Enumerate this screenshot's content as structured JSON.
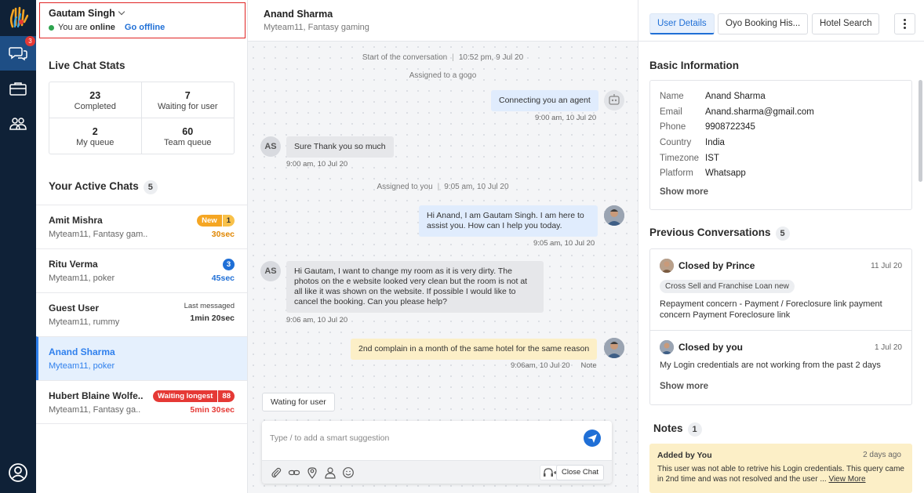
{
  "colors": {
    "rail_bg": "#0f2137",
    "accent": "#1f6fd6",
    "alert": "#e53935",
    "online": "#2ea44f",
    "note_bg": "#fcefc7"
  },
  "rail": {
    "chat_badge": "3"
  },
  "agent": {
    "name": "Gautam Singh",
    "status_prefix": "You are",
    "status": "online",
    "go_offline": "Go offline"
  },
  "stats": {
    "title": "Live Chat Stats",
    "items": [
      {
        "value": "23",
        "label": "Completed"
      },
      {
        "value": "7",
        "label": "Waiting for user"
      },
      {
        "value": "2",
        "label": "My queue"
      },
      {
        "value": "60",
        "label": "Team queue"
      }
    ]
  },
  "active_chats": {
    "title": "Your Active Chats",
    "count": "5",
    "items": [
      {
        "name": "Amit Mishra",
        "sub": "Myteam11, Fantasy gam..",
        "tag": "New",
        "tag_count": "1",
        "time": "30sec"
      },
      {
        "name": "Ritu Verma",
        "sub": "Myteam11, poker",
        "badge": "3",
        "time": "45sec"
      },
      {
        "name": "Guest User",
        "sub": "Myteam11, rummy",
        "note": "Last messaged",
        "time": "1min 20sec"
      },
      {
        "name": "Anand Sharma",
        "sub": "Myteam11, poker"
      },
      {
        "name": "Hubert Blaine Wolfe..",
        "sub": "Myteam11, Fantasy ga..",
        "tag": "Waiting longest",
        "tag_count": "88",
        "time": "5min 30sec"
      }
    ]
  },
  "conversation": {
    "title": "Anand Sharma",
    "subtitle": "Myteam11, Fantasy gaming",
    "start_label": "Start of the conversation",
    "start_time": "10:52 pm, 9 Jul 20",
    "assigned_gogo": "Assigned to a gogo",
    "assigned_you": "Assigned to you",
    "assigned_you_time": "9:05 am, 10 Jul 20",
    "messages": [
      {
        "text": "Connecting you an agent",
        "time": "9:00 am, 10 Jul 20"
      },
      {
        "avatar": "AS",
        "text": "Sure Thank you so much",
        "time": "9:00 am,  10 Jul 20"
      },
      {
        "text": "Hi Anand, I am Gautam Singh. I am here to assist you. How can I help you today.",
        "time": "9:05 am,  10 Jul 20"
      },
      {
        "avatar": "AS",
        "text": "Hi Gautam, I want to change my room as it is very dirty. The photos on the e website looked very clean but the room is not at all like it was shown on the website. If possible I would like to cancel the booking. Can you please help?",
        "time": "9:06 am,  10 Jul 20"
      },
      {
        "text": "2nd complain in a month of the same hotel for the same reason",
        "time": "9:06am, 10 Jul 20",
        "note": "Note"
      }
    ],
    "waiting_button": "Wating for user",
    "composer_placeholder": "Type / to add a smart suggestion",
    "close_chat": "Close Chat"
  },
  "tabs": [
    "User Details",
    "Oyo Booking His...",
    "Hotel Search"
  ],
  "basic_info": {
    "title": "Basic Information",
    "rows": [
      {
        "k": "Name",
        "v": "Anand Sharma"
      },
      {
        "k": "Email",
        "v": "Anand.sharma@gmail.com"
      },
      {
        "k": "Phone",
        "v": "9908722345"
      },
      {
        "k": "Country",
        "v": "India"
      },
      {
        "k": "Timezone",
        "v": "IST"
      },
      {
        "k": "Platform",
        "v": "Whatsapp"
      }
    ],
    "show_more": "Show more"
  },
  "previous": {
    "title": "Previous Conversations",
    "count": "5",
    "items": [
      {
        "closed": "Closed by Prince",
        "date": "11 Jul 20",
        "tag": "Cross Sell and Franchise Loan new",
        "text": "Repayment concern - Payment / Foreclosure link payment concern Payment Foreclosure link"
      },
      {
        "closed": "Closed by you",
        "date": "1 Jul 20",
        "text": "My Login credentials are not working from the past 2 days"
      }
    ],
    "show_more": "Show more"
  },
  "notes": {
    "title": "Notes",
    "count": "1",
    "by": "Added by You",
    "ago": "2 days ago",
    "text": "This user was not able to retrive his Login credentials. This query came in 2nd time and was not resolved and the user ...",
    "view_more": "View More"
  }
}
